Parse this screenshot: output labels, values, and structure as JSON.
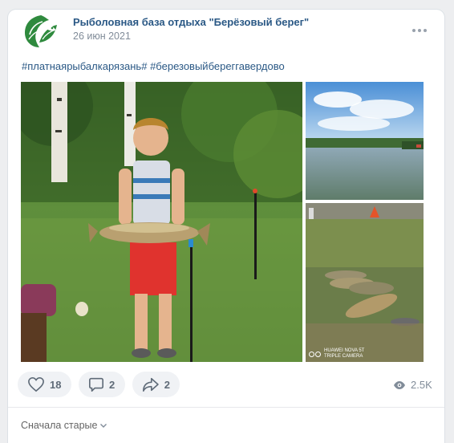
{
  "post": {
    "author": "Рыболовная база отдыха \"Берёзовый берег\"",
    "date": "26 июн 2021",
    "hashtags": [
      "#платнаярыбалкарязань#",
      "#березовыйбереггавердово"
    ],
    "photos": [
      {
        "description": "boy-holding-fish"
      },
      {
        "description": "pond-landscape"
      },
      {
        "description": "fish-on-grass",
        "watermark_line1": "HUAWEI NOVA 5T",
        "watermark_line2": "TRIPLE CAMERA"
      }
    ]
  },
  "actions": {
    "likes": "18",
    "comments": "2",
    "shares": "2",
    "views": "2.5K"
  },
  "comments_sort": {
    "label": "Сначала старые"
  },
  "colors": {
    "link": "#2a5885",
    "secondary": "#818c99",
    "pill_bg": "#f0f2f5",
    "icon": "#5f6b78"
  }
}
